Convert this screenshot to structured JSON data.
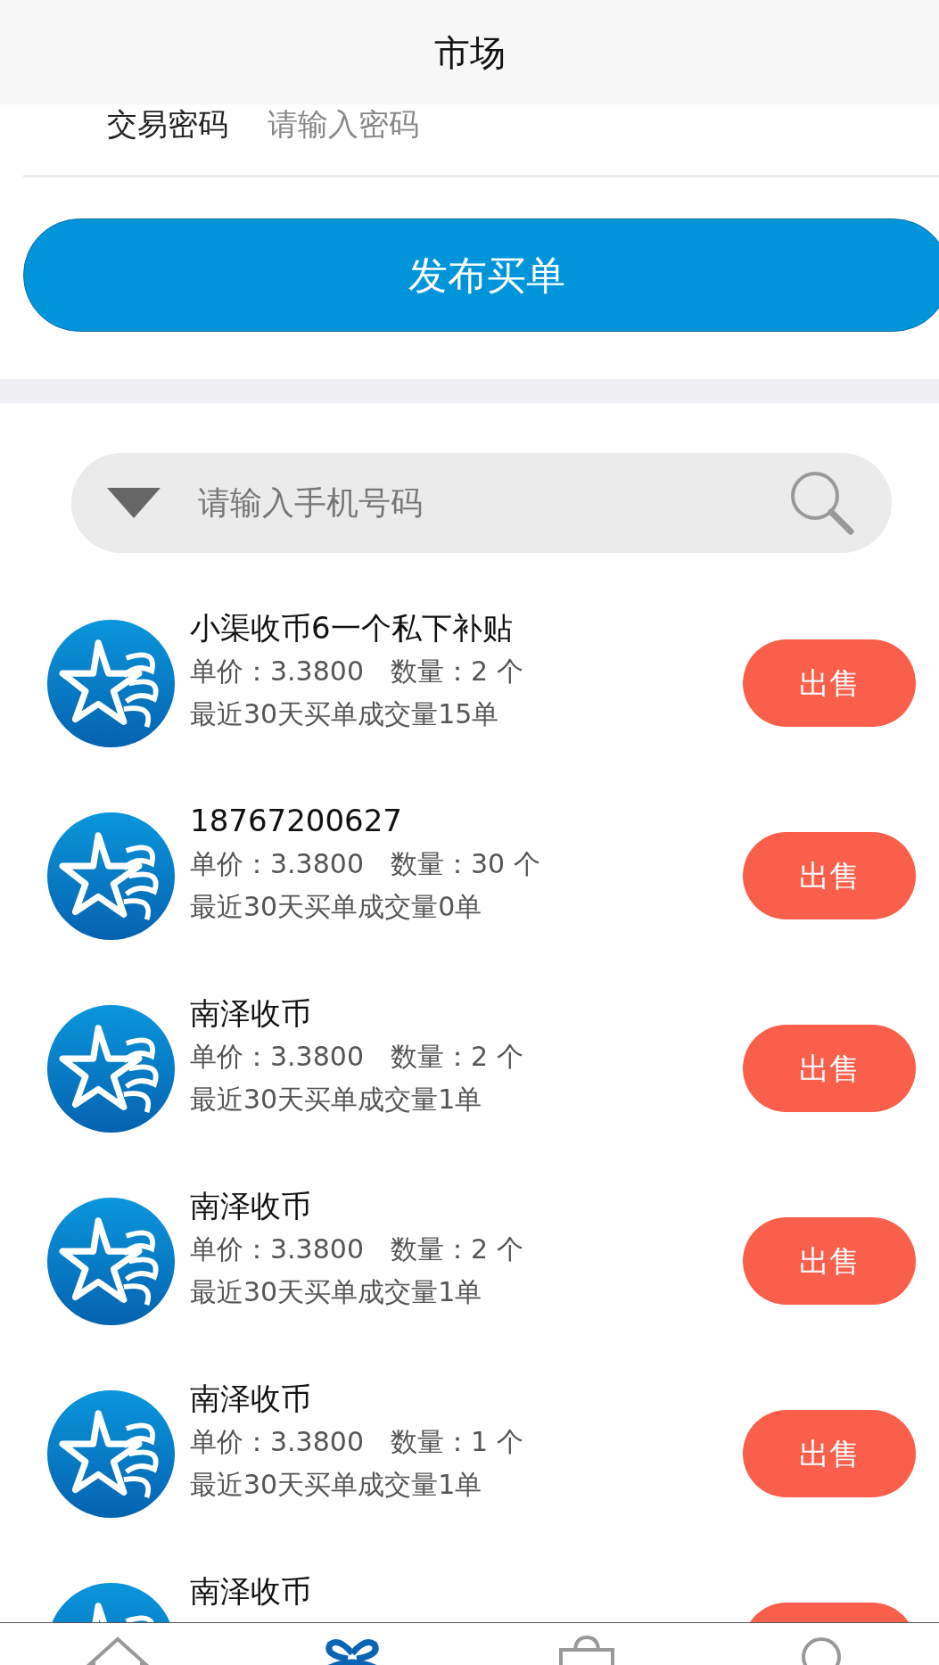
{
  "header": {
    "title": "市场"
  },
  "password": {
    "label": "交易密码",
    "placeholder": "请输入密码"
  },
  "publish_button": "发布买单",
  "search": {
    "placeholder": "请输入手机号码"
  },
  "orders": [
    {
      "name": "小渠收币6一个私下补贴",
      "price": "单价：3.3800",
      "quantity": "数量：2 个",
      "volume": "最近30天买单成交量15单",
      "button": "出售"
    },
    {
      "name": "18767200627",
      "price": "单价：3.3800",
      "quantity": "数量：30 个",
      "volume": "最近30天买单成交量0单",
      "button": "出售"
    },
    {
      "name": "南泽收币",
      "price": "单价：3.3800",
      "quantity": "数量：2 个",
      "volume": "最近30天买单成交量1单",
      "button": "出售"
    },
    {
      "name": "南泽收币",
      "price": "单价：3.3800",
      "quantity": "数量：2 个",
      "volume": "最近30天买单成交量1单",
      "button": "出售"
    },
    {
      "name": "南泽收币",
      "price": "单价：3.3800",
      "quantity": "数量：1 个",
      "volume": "最近30天买单成交量1单",
      "button": "出售"
    },
    {
      "name": "南泽收币"
    }
  ],
  "bottom_nav": [
    {
      "selected": false
    },
    {
      "selected": true
    },
    {
      "selected": false
    },
    {
      "selected": false
    }
  ]
}
